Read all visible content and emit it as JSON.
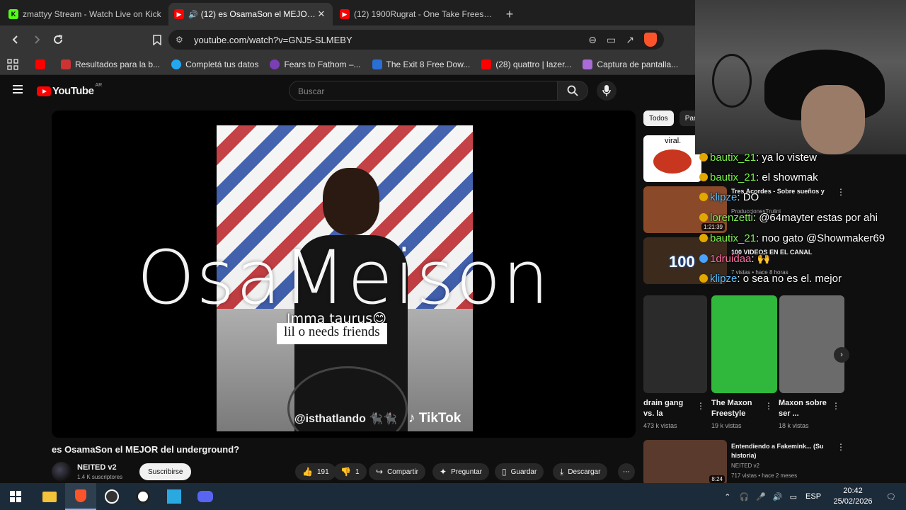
{
  "tabs": [
    {
      "title": "zmattyy Stream - Watch Live on Kick",
      "favicon": "kick-icon",
      "color": "#53fc18"
    },
    {
      "title": "(12) es OsamaSon el MEJOR del underground?",
      "favicon": "youtube-icon",
      "color": "#ff0000",
      "active": true
    },
    {
      "title": "(12) 1900Rugrat - One Take Freestyle",
      "favicon": "youtube-icon",
      "color": "#ff0000"
    }
  ],
  "address": {
    "url": "youtube.com/watch?v=GNJ5-SLMEBY"
  },
  "bookmarks": [
    {
      "label": "",
      "color": "#ff0000"
    },
    {
      "label": "Resultados para la b...",
      "color": "#cc3333"
    },
    {
      "label": "Completá tus datos",
      "color": "#22a7f0"
    },
    {
      "label": "Fears to Fathom –...",
      "color": "#7b3fb5"
    },
    {
      "label": "The Exit 8 Free Dow...",
      "color": "#2a6fd6"
    },
    {
      "label": "(28) quattro | lazer...",
      "color": "#ff0000"
    },
    {
      "label": "Captura de pantalla...",
      "color": "#a86bd8"
    }
  ],
  "youtube": {
    "logo": "YouTube",
    "country": "AR",
    "search_placeholder": "Buscar"
  },
  "video": {
    "overlay_text": "OsaMeison",
    "caption_1": "Imma taurus😊",
    "caption_2": "lil o needs friends",
    "watermark": "@isthatlando 🐈‍⬛🐈‍⬛",
    "tiktok": "TikTok",
    "title": "es OsamaSon el MEJOR del underground?",
    "channel": "NEITED v2",
    "subs": "1.4 K suscriptores",
    "subscribe": "Suscribirse",
    "likes": "191",
    "dislikes": "1",
    "share": "Compartir",
    "ask": "Preguntar",
    "save": "Guardar",
    "download": "Descargar"
  },
  "sidebar": {
    "chips": [
      "Todos",
      "Par"
    ],
    "thumb1_text": "viral.",
    "thumb2_duration": "1:21:39",
    "item_titles": [
      "Tres Acordes - Sobre sueños y",
      "100 VIDEOS EN EL CANAL"
    ],
    "item2_channel": "ProduccionesTrulini",
    "item3_meta": "7 vistas • hace 8 horas",
    "shorts": [
      {
        "title": "drain gang vs. la",
        "views": "473 k vistas"
      },
      {
        "title": "The Maxon Freestyle",
        "views": "19 k vistas"
      },
      {
        "title": "Maxon sobre ser ...",
        "views": "18 k vistas"
      }
    ],
    "last": {
      "title": "Entendiendo a Fakemink... (Su historia)",
      "channel": "NEITED v2",
      "meta": "717 vistas • hace 2 meses",
      "duration": "8:24"
    }
  },
  "chat": [
    {
      "user": "bautix_21",
      "msg": ": ya lo vistew",
      "color": "green"
    },
    {
      "user": "bautix_21",
      "msg": ": el showmak",
      "color": "green"
    },
    {
      "user": "klipze",
      "msg": ": DO",
      "color": "blue"
    },
    {
      "user": "lorenzetti",
      "msg": ": @64mayter estas por ahi",
      "color": "green"
    },
    {
      "user": "bautix_21",
      "msg": ": noo gato @Showmaker69",
      "color": "green"
    },
    {
      "user": "1druidaa",
      "msg": ": 🙌",
      "color": "pink"
    },
    {
      "user": "klipze",
      "msg": ": o sea no es el. mejor",
      "color": "blue"
    }
  ],
  "taskbar": {
    "lang": "ESP",
    "time": "20:42",
    "date": "25/02/2026"
  },
  "colors": {
    "accent": "#ff0000",
    "taskbar": "#1c2b39"
  }
}
